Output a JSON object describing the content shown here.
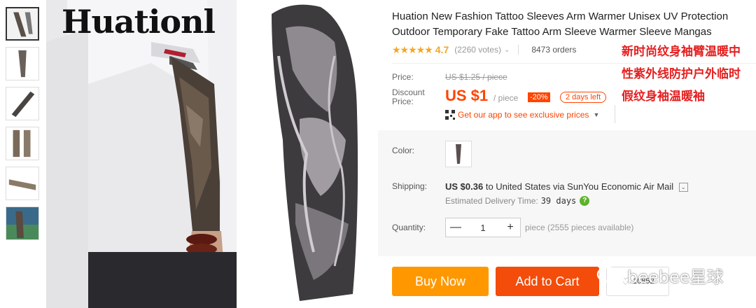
{
  "thumbnails": [
    {
      "name": "thumb-1"
    },
    {
      "name": "thumb-2"
    },
    {
      "name": "thumb-3"
    },
    {
      "name": "thumb-4"
    },
    {
      "name": "thumb-5"
    },
    {
      "name": "thumb-6"
    }
  ],
  "main_image": {
    "logo": "Huationl"
  },
  "product": {
    "title": "Huation New Fashion Tattoo Sleeves Arm Warmer Unisex UV Protection Outdoor Temporary Fake Tattoo Arm Sleeve Warmer Sleeve Mangas",
    "stars": "★★★★★",
    "rating": "4.7",
    "votes": "(2260 votes)",
    "orders": "8473 orders"
  },
  "overlay_cn": [
    "新时尚纹身袖臂温暖中",
    "性紫外线防护户外临时",
    "假纹身袖温暖袖"
  ],
  "price": {
    "label": "Price:",
    "original": "US $1.25 / piece",
    "discount_label": "Discount Price:",
    "current": "US $1",
    "per_piece": "/ piece",
    "discount_pct": "-20%",
    "days_left": "2 days left",
    "app_promo": "Get our app to see exclusive prices"
  },
  "color": {
    "label": "Color:"
  },
  "shipping": {
    "label": "Shipping:",
    "cost": "US $0.36",
    "text": "to United States via SunYou Economic Air Mail",
    "eta_label": "Estimated Delivery Time:",
    "eta_value": "39 days"
  },
  "quantity": {
    "label": "Quantity:",
    "value": "1",
    "available": "piece (2555 pieces available)"
  },
  "actions": {
    "buy_now": "Buy Now",
    "add_to_cart": "Add to Cart",
    "wishlist_count": "10852"
  },
  "watermark": "beebee星球",
  "colors": {
    "accent": "#ff4400",
    "buy": "#ff9800",
    "cart": "#f44c0b",
    "star": "#f5a623"
  }
}
